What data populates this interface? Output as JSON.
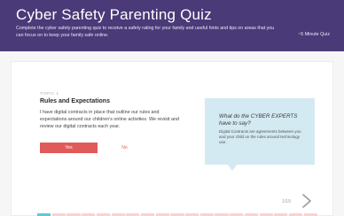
{
  "header": {
    "title": "Cyber Safety Parenting Quiz",
    "description": "Complete the cyber safety parenting quiz to receive a safety rating for your family and useful hints and tips on areas that you can focus on to keep your family safe online.",
    "duration": "~5 Minute Quiz"
  },
  "question": {
    "topic_label": "TOPIC 1",
    "topic_title": "Rules and Expectations",
    "text": "I have digital contracts in place that outline our rules and expectations around our children's online activities. We revisit and review our digital contracts each year.",
    "yes_label": "Yes",
    "no_label": "No"
  },
  "experts": {
    "heading": "What do the CYBER EXPERTS have to say?",
    "text": "Digital Contracts are agreements between you and your child on the rules around technology use."
  },
  "pager": {
    "text": "1/19",
    "current": 1,
    "total": 19
  },
  "icons": {
    "next": "chevron-right-icon"
  },
  "colors": {
    "header_bg": "#4a3a78",
    "accent": "#e05a5a",
    "expert_bg": "#d3eaf2",
    "progress_done": "#5ec9d0",
    "progress_todo": "#f7d3d3"
  }
}
